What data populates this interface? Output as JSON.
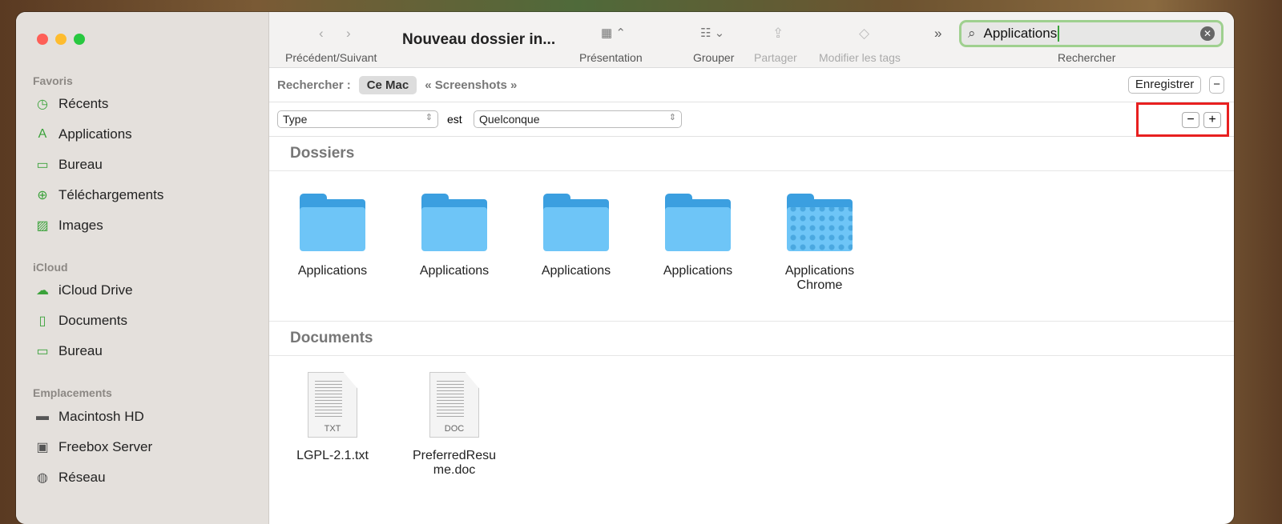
{
  "sidebar": {
    "sections": [
      {
        "title": "Favoris",
        "items": [
          {
            "label": "Récents",
            "icon": "clock-icon"
          },
          {
            "label": "Applications",
            "icon": "applications-icon"
          },
          {
            "label": "Bureau",
            "icon": "desktop-icon"
          },
          {
            "label": "Téléchargements",
            "icon": "download-icon"
          },
          {
            "label": "Images",
            "icon": "photo-icon"
          }
        ]
      },
      {
        "title": "iCloud",
        "items": [
          {
            "label": "iCloud Drive",
            "icon": "cloud-icon"
          },
          {
            "label": "Documents",
            "icon": "document-icon"
          },
          {
            "label": "Bureau",
            "icon": "desktop-icon"
          }
        ]
      },
      {
        "title": "Emplacements",
        "items": [
          {
            "label": "Macintosh HD",
            "icon": "disk-icon"
          },
          {
            "label": "Freebox Server",
            "icon": "display-icon"
          },
          {
            "label": "Réseau",
            "icon": "globe-icon"
          }
        ]
      }
    ]
  },
  "toolbar": {
    "title": "Nouveau dossier in...",
    "nav_label": "Précédent/Suivant",
    "view_label": "Présentation",
    "group_label": "Grouper",
    "share_label": "Partager",
    "tags_label": "Modifier les tags",
    "search_label": "Rechercher",
    "search_value": "Applications"
  },
  "scope": {
    "label": "Rechercher :",
    "this_mac": "Ce Mac",
    "folder": "« Screenshots »",
    "save": "Enregistrer"
  },
  "criteria": {
    "attribute": "Type",
    "operator": "est",
    "value": "Quelconque"
  },
  "groups": {
    "folders": {
      "title": "Dossiers",
      "items": [
        "Applications",
        "Applications",
        "Applications",
        "Applications",
        "Applications Chrome"
      ]
    },
    "documents": {
      "title": "Documents",
      "items": [
        {
          "name": "LGPL-2.1.txt",
          "ext": "TXT"
        },
        {
          "name": "PreferredResume.doc",
          "ext": "DOC"
        }
      ]
    }
  }
}
